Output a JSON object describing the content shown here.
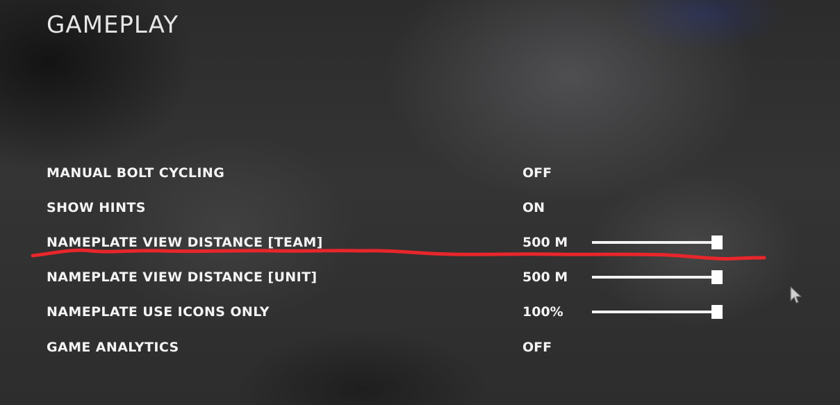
{
  "section": {
    "title": "GAMEPLAY"
  },
  "settings": [
    {
      "label": "MANUAL BOLT CYCLING",
      "value": "OFF"
    },
    {
      "label": "SHOW HINTS",
      "value": "ON"
    },
    {
      "label": "NAMEPLATE VIEW DISTANCE [TEAM]",
      "value": "500 M",
      "slider_fraction": 1.0
    },
    {
      "label": "NAMEPLATE VIEW DISTANCE [UNIT]",
      "value": "500 M",
      "slider_fraction": 1.0
    },
    {
      "label": "NAMEPLATE USE ICONS ONLY",
      "value": "100%",
      "slider_fraction": 1.0
    },
    {
      "label": "GAME ANALYTICS",
      "value": "OFF"
    }
  ],
  "annotation": {
    "color": "#e8262b",
    "highlighted_setting": "NAMEPLATE VIEW DISTANCE [TEAM]"
  },
  "cursor": {
    "icon": "arrow-cursor-icon"
  }
}
